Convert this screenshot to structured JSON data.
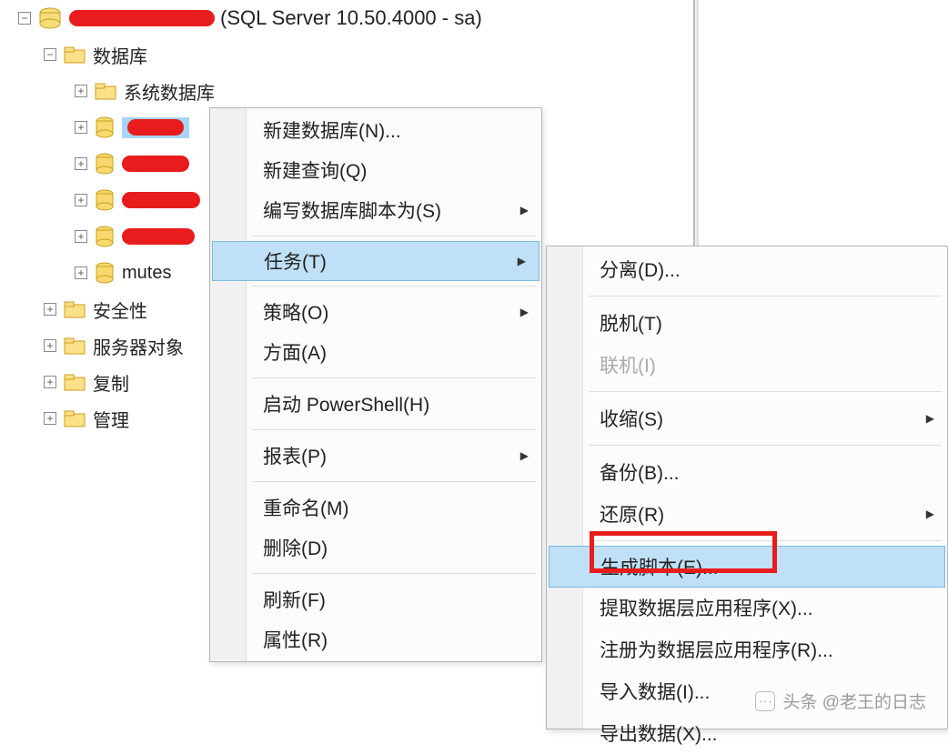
{
  "server": {
    "label_suffix": "(SQL Server 10.50.4000 - sa)"
  },
  "tree": {
    "databases": "数据库",
    "system_db": "系统数据库",
    "db_mutest": "mutes",
    "security": "安全性",
    "server_objects": "服务器对象",
    "replication": "复制",
    "management": "管理"
  },
  "menu1": {
    "new_database": "新建数据库(N)...",
    "new_query": "新建查询(Q)",
    "script_db_as": "编写数据库脚本为(S)",
    "tasks": "任务(T)",
    "policies": "策略(O)",
    "facets": "方面(A)",
    "start_powershell": "启动 PowerShell(H)",
    "reports": "报表(P)",
    "rename": "重命名(M)",
    "delete": "删除(D)",
    "refresh": "刷新(F)",
    "properties": "属性(R)"
  },
  "menu2": {
    "detach": "分离(D)...",
    "take_offline": "脱机(T)",
    "bring_online": "联机(I)",
    "shrink": "收缩(S)",
    "backup": "备份(B)...",
    "restore": "还原(R)",
    "generate_scripts": "生成脚本(E)...",
    "extract_data_tier": "提取数据层应用程序(X)...",
    "register_data_tier": "注册为数据层应用程序(R)...",
    "import_data": "导入数据(I)...",
    "export_data": "导出数据(X)..."
  },
  "watermark": "头条 @老王的日志"
}
